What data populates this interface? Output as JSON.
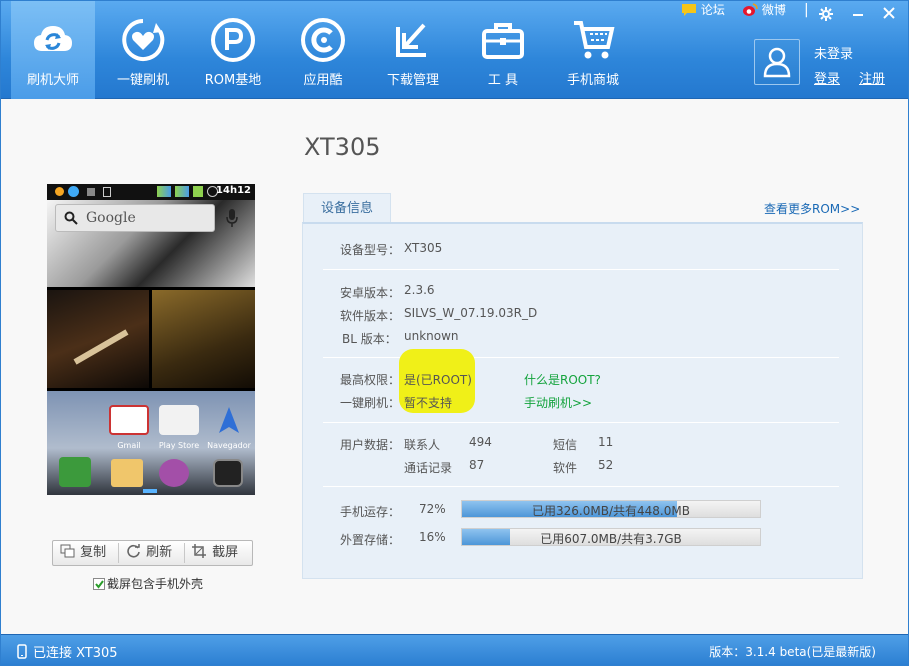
{
  "top_links": {
    "forum": "论坛",
    "weibo": "微博"
  },
  "nav": [
    {
      "label": "刷机大师",
      "icon": "cloud-refresh-icon",
      "active": true
    },
    {
      "label": "一键刷机",
      "icon": "heart-refresh-icon"
    },
    {
      "label": "ROM基地",
      "icon": "rom-r-icon"
    },
    {
      "label": "应用酷",
      "icon": "app-c-icon"
    },
    {
      "label": "下载管理",
      "icon": "download-arrow-icon"
    },
    {
      "label": "工  具",
      "icon": "toolbox-icon"
    },
    {
      "label": "手机商城",
      "icon": "cart-icon"
    }
  ],
  "user": {
    "status": "未登录",
    "login": "登录",
    "register": "注册"
  },
  "device": {
    "title": "XT305"
  },
  "phone": {
    "clock": "14h12",
    "search_label": "Google",
    "apps": [
      "Gmail",
      "Play Store",
      "Navegador"
    ]
  },
  "phone_actions": {
    "copy": "复制",
    "refresh": "刷新",
    "screenshot": "截屏",
    "include_shell": "截屏包含手机外壳"
  },
  "info": {
    "tab": "设备信息",
    "more_rom": "查看更多ROM>>",
    "model_label": "设备型号：",
    "model": "XT305",
    "android_label": "安卓版本：",
    "android": "2.3.6",
    "software_label": "软件版本：",
    "software": "SILVS_W_07.19.03R_D",
    "bl_label": "BL 版本：",
    "bl": "unknown",
    "root_label": "最高权限：",
    "root": "是(已ROOT)",
    "what_root": "什么是ROOT?",
    "flash_label": "一键刷机：",
    "flash": "暂不支持",
    "manual_flash": "手动刷机>>",
    "userdata_label": "用户数据：",
    "contacts_label": "联系人",
    "contacts": "494",
    "sms_label": "短信",
    "sms": "11",
    "calls_label": "通话记录",
    "calls": "87",
    "software_count_label": "软件",
    "software_count": "52",
    "ram_label": "手机运存：",
    "ram_pct": "72%",
    "ram_fill": 0.72,
    "ram_text": "已用326.0MB/共有448.0MB",
    "ext_label": "外置存储：",
    "ext_pct": "16%",
    "ext_fill": 0.16,
    "ext_text": "已用607.0MB/共有3.7GB"
  },
  "footer": {
    "connected": "已连接 XT305",
    "version": "版本：3.1.4 beta(已是最新版)"
  }
}
